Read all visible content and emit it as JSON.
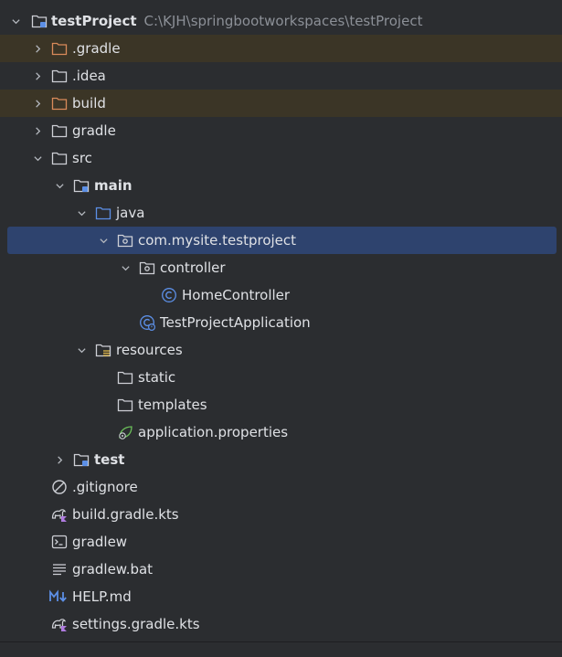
{
  "project": {
    "name": "testProject",
    "path": "C:\\KJH\\springbootworkspaces\\testProject"
  },
  "items": [
    {
      "label": ".gradle"
    },
    {
      "label": ".idea"
    },
    {
      "label": "build"
    },
    {
      "label": "gradle"
    },
    {
      "label": "src"
    },
    {
      "label": "main"
    },
    {
      "label": "java"
    },
    {
      "label": "com.mysite.testproject"
    },
    {
      "label": "controller"
    },
    {
      "label": "HomeController"
    },
    {
      "label": "TestProjectApplication"
    },
    {
      "label": "resources"
    },
    {
      "label": "static"
    },
    {
      "label": "templates"
    },
    {
      "label": "application.properties"
    },
    {
      "label": "test"
    },
    {
      "label": ".gitignore"
    },
    {
      "label": "build.gradle.kts"
    },
    {
      "label": "gradlew"
    },
    {
      "label": "gradlew.bat"
    },
    {
      "label": "HELP.md"
    },
    {
      "label": "settings.gradle.kts"
    }
  ],
  "colors": {
    "background": "#2b2d30",
    "selection": "#2e436e",
    "excluded": "#3b3526",
    "folder_excluded": "#d98a5a",
    "folder_source": "#5c8fe6",
    "class_icon": "#5c8fe6",
    "spring_icon": "#6bbf59"
  },
  "icons": {
    "module": "module-folder-icon",
    "folder": "folder-icon",
    "excluded_folder": "excluded-folder-icon",
    "source_root": "source-root-folder-icon",
    "package": "package-icon",
    "class": "class-icon",
    "spring_app": "spring-application-icon",
    "resources": "resources-root-icon",
    "properties": "spring-properties-icon",
    "gitignore": "ignore-file-icon",
    "gradle_kts": "gradle-kotlin-icon",
    "shell": "shell-script-icon",
    "bat": "batch-file-icon",
    "markdown": "markdown-icon"
  }
}
